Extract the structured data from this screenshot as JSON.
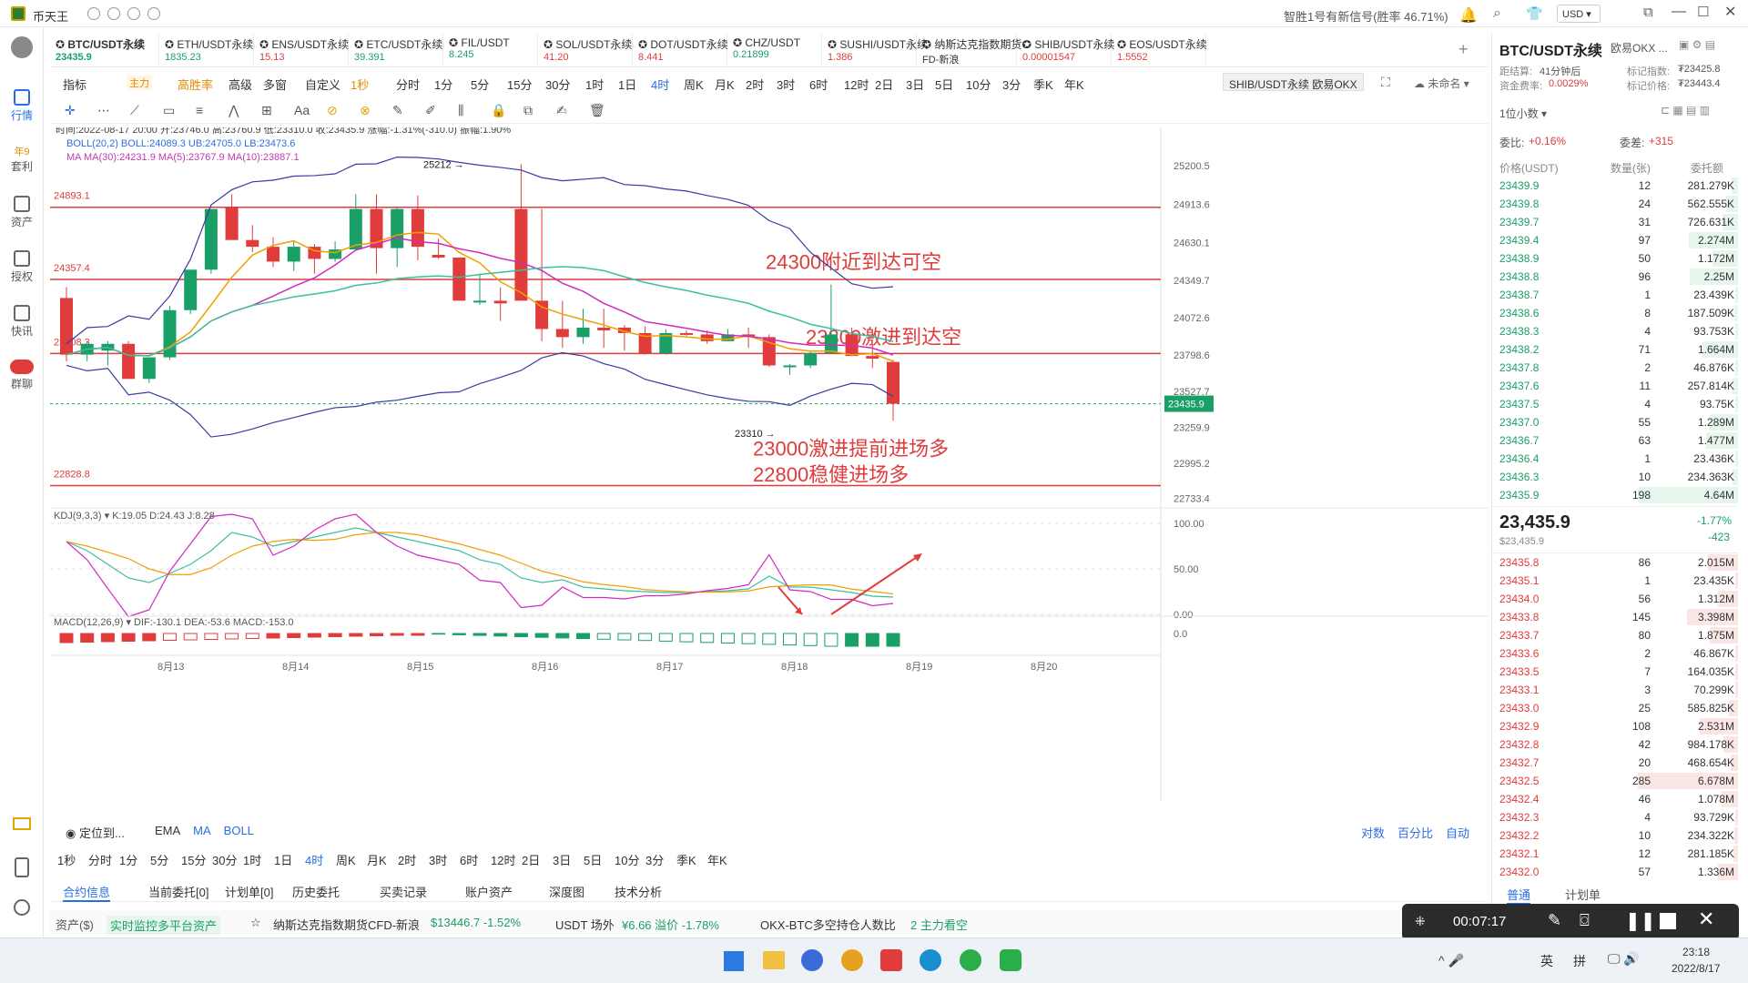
{
  "app": {
    "title": "币天王",
    "signal": "智胜1号有新信号(胜率 46.71%)",
    "currency": "USD"
  },
  "sidebar": [
    {
      "label": "行情"
    },
    {
      "label": "套利",
      "badge": "年9"
    },
    {
      "label": "资产"
    },
    {
      "label": "授权"
    },
    {
      "label": "快讯"
    },
    {
      "label": "群聊"
    }
  ],
  "tickers": [
    {
      "name": "BTC/USDT永续",
      "price": "23435.9",
      "color": "#1a9f66"
    },
    {
      "name": "ETH/USDT永续",
      "price": "1835.23",
      "color": "#1a9f66"
    },
    {
      "name": "ENS/USDT永续",
      "price": "15.13",
      "color": "#e03c3c"
    },
    {
      "name": "ETC/USDT永续",
      "price": "39.391",
      "color": "#1a9f66"
    },
    {
      "name": "FIL/USDT",
      "price": "8.245",
      "color": "#1a9f66"
    },
    {
      "name": "SOL/USDT永续",
      "price": "41.20",
      "color": "#e03c3c"
    },
    {
      "name": "DOT/USDT永续",
      "price": "8.441",
      "color": "#e03c3c"
    },
    {
      "name": "CHZ/USDT",
      "price": "0.21899",
      "color": "#1a9f66"
    },
    {
      "name": "SUSHI/USDT永续",
      "price": "1.386",
      "color": "#e03c3c"
    },
    {
      "name": "纳斯达克指数期货C",
      "price": "FD-新浪",
      "color": "#333333"
    },
    {
      "name": "SHIB/USDT永续",
      "price": "0.00001547",
      "color": "#e03c3c"
    },
    {
      "name": "EOS/USDT永续",
      "price": "1.5552",
      "color": "#e03c3c"
    }
  ],
  "toolbar": {
    "items": [
      "指标",
      "主力",
      "高胜率",
      "高级",
      "多窗",
      "自定义",
      "1秒",
      "分时",
      "1分",
      "5分",
      "15分",
      "30分",
      "1时",
      "1日",
      "4时",
      "周K",
      "月K",
      "2时",
      "3时",
      "6时",
      "12时",
      "2日",
      "3日",
      "5日",
      "10分",
      "3分",
      "季K",
      "年K"
    ],
    "pair_tag": "SHIB/USDT永续 欧易OKX",
    "unnamed": "未命名"
  },
  "chart_info": {
    "ohlc": "时间:2022-08-17 20:00  开:23746.0  高:23760.9  低:23310.0  收:23435.9  涨幅:-1.31%(-310.0)  振幅:1.90%",
    "boll": "BOLL(20,2)   BOLL:24089.3  UB:24705.0  LB:23473.6",
    "ma": "MA   MA(30):24231.9  MA(5):23767.9  MA(10):23887.1",
    "kdj": "KDJ(9,3,3)  ▾  K:19.05  D:24.43  J:8.28",
    "macd": "MACD(12,26,9)  ▾  DIF:-130.1  DEA:-53.6  MACD:-153.0"
  },
  "chart_data": {
    "type": "candlestick",
    "title": "BTC/USDT永续 4时",
    "x_labels": [
      "8月13",
      "8月14",
      "8月15",
      "8月16",
      "8月17",
      "8月18",
      "8月19",
      "8月20"
    ],
    "y_ticks": [
      25200.5,
      24913.6,
      24630.1,
      24349.7,
      24072.6,
      23798.6,
      23527.7,
      23259.9,
      22995.2,
      22733.4
    ],
    "last_price": 23435.9,
    "high_label": "25212",
    "low_label": "23310",
    "hlines": [
      {
        "value": 24893.1,
        "label": "24893.1"
      },
      {
        "value": 24357.4,
        "label": "24357.4"
      },
      {
        "value": 23808.3,
        "label": "23808.3"
      },
      {
        "value": 22828.8,
        "label": "22828.8"
      }
    ],
    "annotations": [
      {
        "text": "24300附近到达可空"
      },
      {
        "text": "23800激进到达空"
      },
      {
        "text": "23000激进提前进场多"
      },
      {
        "text": "22800稳健进场多"
      }
    ],
    "candles": [
      [
        24220,
        24300,
        23750,
        23800
      ],
      [
        23800,
        23900,
        23750,
        23880
      ],
      [
        23830,
        23900,
        23720,
        23880
      ],
      [
        23880,
        23900,
        23720,
        23620
      ],
      [
        23620,
        23780,
        23590,
        23780
      ],
      [
        23780,
        24160,
        23760,
        24130
      ],
      [
        24130,
        24420,
        24100,
        24430
      ],
      [
        24430,
        24880,
        24400,
        24880
      ],
      [
        24890,
        24990,
        24700,
        24650
      ],
      [
        24650,
        24760,
        24560,
        24600
      ],
      [
        24600,
        24670,
        24450,
        24490
      ],
      [
        24490,
        24640,
        24420,
        24600
      ],
      [
        24600,
        24620,
        24400,
        24510
      ],
      [
        24510,
        24640,
        24490,
        24580
      ],
      [
        24580,
        24990,
        24580,
        24880
      ],
      [
        24880,
        24990,
        24400,
        24590
      ],
      [
        24590,
        24890,
        24450,
        24880
      ],
      [
        24880,
        24980,
        24500,
        24600
      ],
      [
        24540,
        24660,
        24510,
        24520
      ],
      [
        24520,
        24520,
        24210,
        24200
      ],
      [
        24200,
        24400,
        24170,
        24200
      ],
      [
        24200,
        24300,
        24050,
        24180
      ],
      [
        24880,
        25212,
        24800,
        24200
      ],
      [
        24200,
        24880,
        23900,
        23990
      ],
      [
        23990,
        24200,
        23850,
        23930
      ],
      [
        23930,
        24140,
        23880,
        24000
      ],
      [
        24000,
        24140,
        23850,
        23980
      ],
      [
        24000,
        24020,
        23830,
        23960
      ],
      [
        23960,
        24010,
        23800,
        23810
      ],
      [
        23810,
        23990,
        23800,
        23960
      ],
      [
        23960,
        23980,
        23940,
        23950
      ],
      [
        23950,
        23980,
        23880,
        23900
      ],
      [
        23900,
        23990,
        23900,
        23950
      ],
      [
        23950,
        24000,
        23850,
        23930
      ],
      [
        23930,
        23950,
        23710,
        23720
      ],
      [
        23720,
        23730,
        23650,
        23720
      ],
      [
        23720,
        23820,
        23700,
        23810
      ],
      [
        23810,
        24320,
        23840,
        23950
      ],
      [
        23950,
        24000,
        23800,
        23790
      ],
      [
        23790,
        23880,
        23700,
        23770
      ],
      [
        23746,
        23760.9,
        23310,
        23435.9
      ]
    ],
    "kdj_ticks": [
      100.0,
      50.0,
      0.0
    ],
    "macd_tick": "0.0"
  },
  "bottom_bar": {
    "locate": "定位到...",
    "indicators": [
      "EMA",
      "MA",
      "BOLL"
    ],
    "right": [
      "对数",
      "百分比",
      "自动"
    ],
    "timeframes": [
      "1秒",
      "分时",
      "1分",
      "5分",
      "15分",
      "30分",
      "1时",
      "1日",
      "4时",
      "周K",
      "月K",
      "2时",
      "3时",
      "6时",
      "12时",
      "2日",
      "3日",
      "5日",
      "10分",
      "3分",
      "季K",
      "年K"
    ]
  },
  "tabs": [
    "合约信息",
    "当前委托[0]",
    "计划单[0]",
    "历史委托",
    "买卖记录",
    "账户资产",
    "深度图",
    "技术分析"
  ],
  "footer": {
    "assets": "资产($)",
    "monitor": "实时监控多平台资产",
    "nasdaq": "纳斯达克指数期货CFD-新浪",
    "nasdaq_val": "$13446.7  -1.52%",
    "usdt": "USDT 场外",
    "usdt_val": "¥6.66  溢价 -1.78%",
    "okx": "OKX-BTC多空持仓人数比",
    "okx_val": "2  主力看空"
  },
  "right_panel": {
    "pair": "BTC/USDT永续",
    "exchange": "欧易OKX ...",
    "settle_label": "距结算:",
    "settle": "41分钟后",
    "mark_index_label": "标记指数:",
    "mark_index": "₮23425.8",
    "rate_label": "资金费率:",
    "rate": "0.0029%",
    "mark_price_label": "标记价格:",
    "mark_price": "₮23443.4",
    "decimal": "1位小数",
    "bid_ratio_label": "委比:",
    "bid_ratio": "+0.16%",
    "bid_diff_label": "委差:",
    "bid_diff": "+315",
    "col_price": "价格(USDT)",
    "col_qty": "数量(张)",
    "col_amount": "委托额",
    "last": "23,435.9",
    "last_sub": "$23,435.9",
    "change_pct": "-1.77%",
    "change_abs": "-423",
    "asks": [
      [
        "23439.9",
        "12",
        "281.279K"
      ],
      [
        "23439.8",
        "24",
        "562.555K"
      ],
      [
        "23439.7",
        "31",
        "726.631K"
      ],
      [
        "23439.4",
        "97",
        "2.274M"
      ],
      [
        "23438.9",
        "50",
        "1.172M"
      ],
      [
        "23438.8",
        "96",
        "2.25M"
      ],
      [
        "23438.7",
        "1",
        "23.439K"
      ],
      [
        "23438.6",
        "8",
        "187.509K"
      ],
      [
        "23438.3",
        "4",
        "93.753K"
      ],
      [
        "23438.2",
        "71",
        "1.664M"
      ],
      [
        "23437.8",
        "2",
        "46.876K"
      ],
      [
        "23437.6",
        "11",
        "257.814K"
      ],
      [
        "23437.5",
        "4",
        "93.75K"
      ],
      [
        "23437.0",
        "55",
        "1.289M"
      ],
      [
        "23436.7",
        "63",
        "1.477M"
      ],
      [
        "23436.4",
        "1",
        "23.436K"
      ],
      [
        "23436.3",
        "10",
        "234.363K"
      ],
      [
        "23435.9",
        "198",
        "4.64M"
      ]
    ],
    "bids": [
      [
        "23435.8",
        "86",
        "2.015M"
      ],
      [
        "23435.1",
        "1",
        "23.435K"
      ],
      [
        "23434.0",
        "56",
        "1.312M"
      ],
      [
        "23433.8",
        "145",
        "3.398M"
      ],
      [
        "23433.7",
        "80",
        "1.875M"
      ],
      [
        "23433.6",
        "2",
        "46.867K"
      ],
      [
        "23433.5",
        "7",
        "164.035K"
      ],
      [
        "23433.1",
        "3",
        "70.299K"
      ],
      [
        "23433.0",
        "25",
        "585.825K"
      ],
      [
        "23432.9",
        "108",
        "2.531M"
      ],
      [
        "23432.8",
        "42",
        "984.178K"
      ],
      [
        "23432.7",
        "20",
        "468.654K"
      ],
      [
        "23432.5",
        "285",
        "6.678M"
      ],
      [
        "23432.4",
        "46",
        "1.078M"
      ],
      [
        "23432.3",
        "4",
        "93.729K"
      ],
      [
        "23432.2",
        "10",
        "234.322K"
      ],
      [
        "23432.1",
        "12",
        "281.185K"
      ],
      [
        "23432.0",
        "57",
        "1.336M"
      ]
    ],
    "tab_normal": "普通",
    "tab_plan": "计划单"
  },
  "recorder": {
    "time": "00:07:17"
  },
  "taskbar": {
    "ime1": "英",
    "ime2": "拼",
    "time": "23:18",
    "date": "2022/8/17"
  }
}
